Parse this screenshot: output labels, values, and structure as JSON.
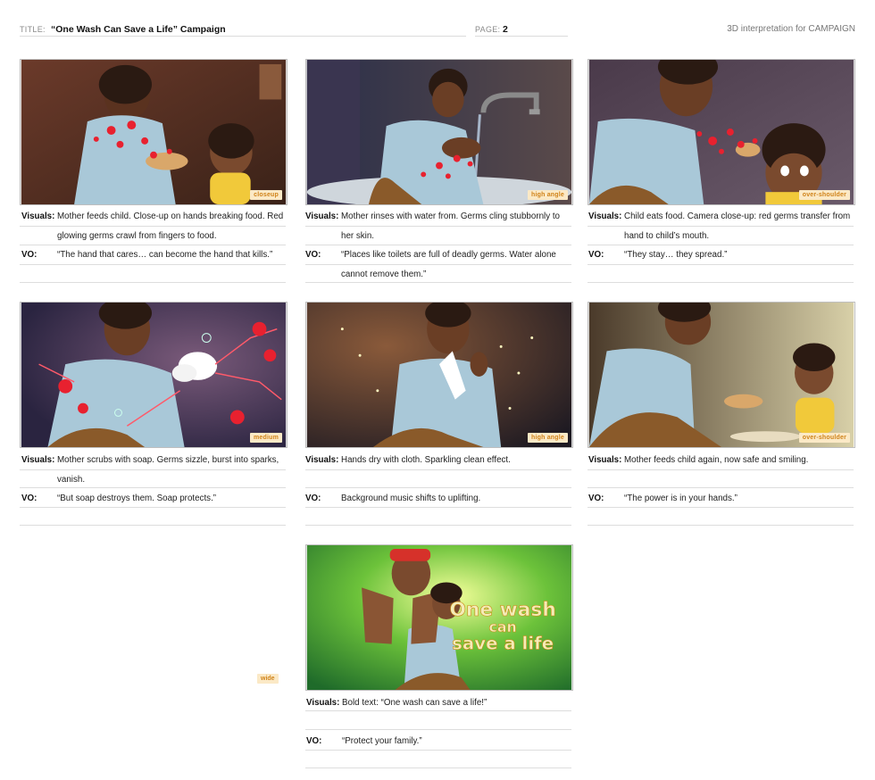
{
  "header": {
    "title_label": "TITLE:",
    "title_value": "“One Wash Can Save a Life” Campaign",
    "page_label": "PAGE:",
    "page_value": "2",
    "right_text": "3D interpretation for CAMPAIGN"
  },
  "labels": {
    "visuals": "Visuals:",
    "vo": "VO:"
  },
  "panels": [
    {
      "shot": "closeup",
      "visuals": "Mother feeds child. Close-up on hands breaking food. Red glowing germs crawl from fingers to food.",
      "vo": "“The hand that cares… can become the hand that kills.”"
    },
    {
      "shot": "high angle",
      "visuals": "Mother rinses with water from. Germs cling stubbornly to her skin.",
      "vo": "“Places like toilets are full of deadly germs. Water alone cannot remove them.”"
    },
    {
      "shot": "over-shoulder",
      "visuals": "Child eats food. Camera close-up: red germs transfer from hand to child’s mouth.",
      "vo": "“They stay… they spread.”"
    },
    {
      "shot": "medium",
      "visuals": "Mother scrubs with soap. Germs sizzle, burst into sparks, vanish.",
      "vo": "“But soap destroys them. Soap protects.”"
    },
    {
      "shot": "high angle",
      "visuals": "Hands dry with cloth. Sparkling clean effect.",
      "vo": "Background music shifts to uplifting."
    },
    {
      "shot": "over-shoulder",
      "visuals": "Mother feeds child again, now safe and smiling.",
      "vo": "“The power is in your hands.”"
    },
    {
      "shot": "wide",
      "visuals": "Bold text: “One wash can save a life!”",
      "vo": "“Protect your family.”",
      "poster_text": [
        "One wash",
        "can",
        "save a life"
      ]
    }
  ],
  "colors": {
    "badge_bg": "#fbe9c6",
    "badge_text": "#d0831a",
    "germ": "#e8212f"
  }
}
